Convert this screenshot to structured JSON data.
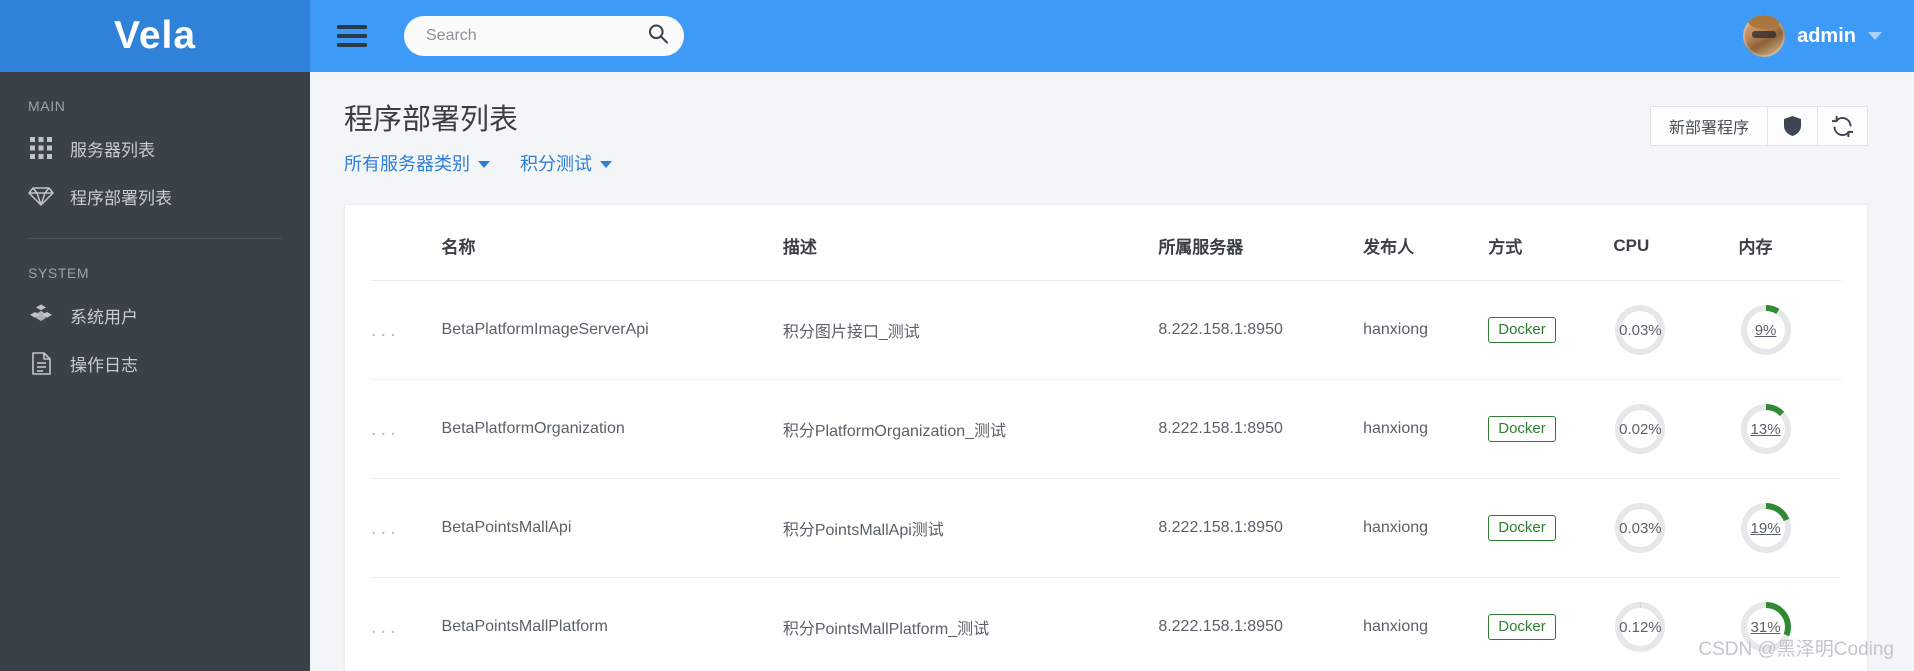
{
  "brand": {
    "name": "Vela"
  },
  "sidebar": {
    "sections": [
      {
        "title": "MAIN",
        "items": [
          {
            "label": "服务器列表",
            "icon": "grid-icon"
          },
          {
            "label": "程序部署列表",
            "icon": "gem-icon"
          }
        ]
      },
      {
        "title": "SYSTEM",
        "items": [
          {
            "label": "系统用户",
            "icon": "cubes-icon"
          },
          {
            "label": "操作日志",
            "icon": "document-icon"
          }
        ]
      }
    ]
  },
  "topbar": {
    "menu_icon": "hamburger-icon",
    "search": {
      "value": "",
      "placeholder": "Search",
      "icon": "search-icon"
    },
    "user": {
      "name": "admin",
      "avatar": "user-avatar",
      "caret": "chevron-down-icon"
    }
  },
  "page": {
    "title": "程序部署列表",
    "filters": [
      {
        "label": "所有服务器类别"
      },
      {
        "label": "积分测试"
      }
    ],
    "actions": {
      "new_deploy": "新部署程序",
      "shield_icon": "shield-icon",
      "refresh_icon": "refresh-icon"
    }
  },
  "table": {
    "columns": [
      "",
      "名称",
      "描述",
      "所属服务器",
      "发布人",
      "方式",
      "CPU",
      "内存"
    ],
    "row_menu": "...",
    "rows": [
      {
        "name": "BetaPlatformImageServerApi",
        "desc": "积分图片接口_测试",
        "server": "8.222.158.1:8950",
        "publisher": "hanxiong",
        "mode": "Docker",
        "cpu": "0.03%",
        "cpu_pct": 0.03,
        "mem": "9%",
        "mem_pct": 9
      },
      {
        "name": "BetaPlatformOrganization",
        "desc": "积分PlatformOrganization_测试",
        "server": "8.222.158.1:8950",
        "publisher": "hanxiong",
        "mode": "Docker",
        "cpu": "0.02%",
        "cpu_pct": 0.02,
        "mem": "13%",
        "mem_pct": 13
      },
      {
        "name": "BetaPointsMallApi",
        "desc": "积分PointsMallApi测试",
        "server": "8.222.158.1:8950",
        "publisher": "hanxiong",
        "mode": "Docker",
        "cpu": "0.03%",
        "cpu_pct": 0.03,
        "mem": "19%",
        "mem_pct": 19
      },
      {
        "name": "BetaPointsMallPlatform",
        "desc": "积分PointsMallPlatform_测试",
        "server": "8.222.158.1:8950",
        "publisher": "hanxiong",
        "mode": "Docker",
        "cpu": "0.12%",
        "cpu_pct": 0.12,
        "mem": "31%",
        "mem_pct": 31
      }
    ]
  },
  "watermark": "CSDN @黑泽明Coding",
  "colors": {
    "brand_blue": "#2f82d8",
    "topbar_blue": "#3d9bf7",
    "sidebar_dark": "#3a4149",
    "link_blue": "#2e7fd8",
    "gauge_green": "#2f8a33",
    "gauge_track": "#e6e7e8"
  }
}
